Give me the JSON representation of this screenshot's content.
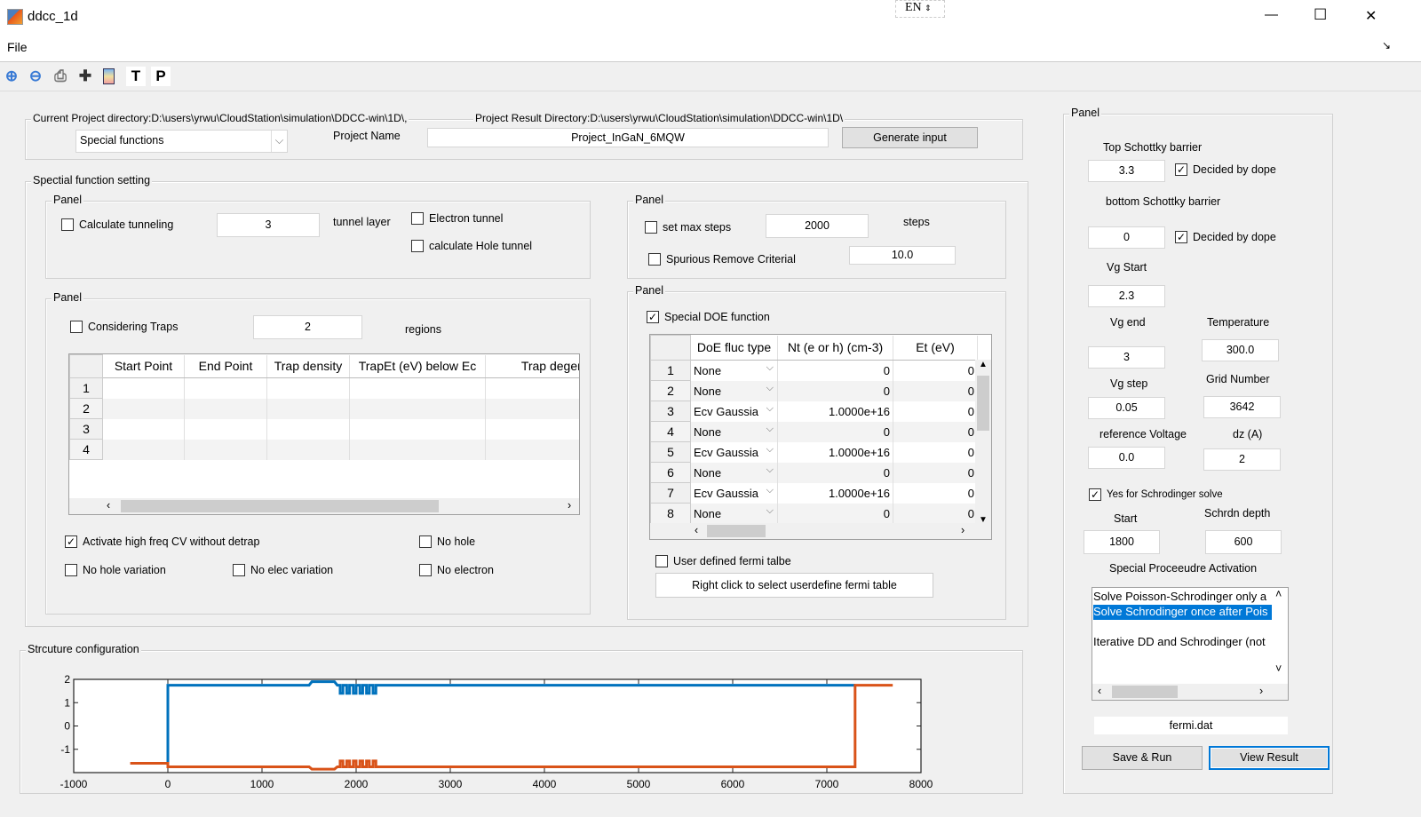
{
  "window": {
    "title": "ddcc_1d",
    "input_indicator": "EN",
    "minimize": "—",
    "maximize": "☐",
    "close": "✕"
  },
  "menu": {
    "file": "File"
  },
  "toolbar": {
    "icons": [
      "zoom-in-icon",
      "zoom-out-icon",
      "print-icon",
      "data-cursor-icon",
      "colorbar-icon",
      "text-icon",
      "p-icon"
    ],
    "t_label": "T",
    "p_label": "P"
  },
  "project": {
    "dir_label": "Current Project directory:D:\\users\\yrwu\\CloudStation\\simulation\\DDCC-win\\1D\\,",
    "result_label": "Project Result Directory:D:\\users\\yrwu\\CloudStation\\simulation\\DDCC-win\\1D\\",
    "mode_select": "Special functions",
    "name_label": "Project Name",
    "name_value": "Project_InGaN_6MQW",
    "generate": "Generate input"
  },
  "special": {
    "title": "Spectial function setting",
    "tunnel_panel": {
      "title": "Panel",
      "calc_tunneling": "Calculate tunneling",
      "tunnel_value": "3",
      "tunnel_layer": "tunnel layer",
      "electron_tunnel": "Electron tunnel",
      "hole_tunnel": "calculate Hole tunnel"
    },
    "steps_panel": {
      "title": "Panel",
      "max_steps": "set max steps",
      "steps_value": "2000",
      "steps": "steps",
      "spurious": "Spurious Remove Criterial",
      "spurious_value": "10.0"
    },
    "trap_panel": {
      "title": "Panel",
      "considering_traps": "Considering Traps",
      "regions_value": "2",
      "regions": "regions",
      "columns": [
        "Start Point",
        "End Point",
        "Trap density",
        "TrapEt (eV) below Ec",
        "Trap degenera"
      ],
      "rows": [
        "1",
        "2",
        "3",
        "4"
      ],
      "activate_cv": "Activate high freq CV without detrap",
      "no_hole": "No hole",
      "no_hole_var": "No hole variation",
      "no_elec_var": "No elec variation",
      "no_electron": "No electron"
    },
    "doe_panel": {
      "title": "Panel",
      "special_doe": "Special DOE function",
      "columns": [
        "DoE fluc type",
        "Nt (e or h) (cm-3)",
        "Et (eV)"
      ],
      "rows": [
        {
          "n": "1",
          "type": "None",
          "nt": "0",
          "et": "0"
        },
        {
          "n": "2",
          "type": "None",
          "nt": "0",
          "et": "0"
        },
        {
          "n": "3",
          "type": "Ecv Gaussia",
          "nt": "1.0000e+16",
          "et": "0"
        },
        {
          "n": "4",
          "type": "None",
          "nt": "0",
          "et": "0"
        },
        {
          "n": "5",
          "type": "Ecv Gaussia",
          "nt": "1.0000e+16",
          "et": "0"
        },
        {
          "n": "6",
          "type": "None",
          "nt": "0",
          "et": "0"
        },
        {
          "n": "7",
          "type": "Ecv Gaussia",
          "nt": "1.0000e+16",
          "et": "0"
        },
        {
          "n": "8",
          "type": "None",
          "nt": "0",
          "et": "0"
        }
      ],
      "user_fermi": "User defined fermi talbe",
      "fermi_button": "Right click to select userdefine fermi table"
    }
  },
  "structure": {
    "title": "Strcuture configuration"
  },
  "right": {
    "title": "Panel",
    "top_schottky": "Top Schottky barrier",
    "top_value": "3.3",
    "decided_by_dope": "Decided by dope",
    "bottom_schottky": "bottom Schottky barrier",
    "bottom_value": "0",
    "vg_start": "Vg Start",
    "vg_start_value": "2.3",
    "vg_end": "Vg end",
    "vg_end_value": "3",
    "temperature": "Temperature",
    "temperature_value": "300.0",
    "vg_step": "Vg step",
    "vg_step_value": "0.05",
    "grid_number": "Grid Number",
    "grid_value": "3642",
    "ref_voltage": "reference Voltage",
    "ref_value": "0.0",
    "dz": "dz (A)",
    "dz_value": "2",
    "schrodinger": "Yes for Schrodinger solve",
    "start": "Start",
    "start_value": "1800",
    "schrdn_depth": "Schrdn depth",
    "depth_value": "600",
    "activation": "Special Proceeudre Activation",
    "list": [
      "Solve Poisson-Schrodinger only a",
      "Solve Schrodinger once after Pois",
      "",
      "Iterative DD and Schrodinger (not"
    ],
    "selected_index": 1,
    "fermi_file": "fermi.dat",
    "save_run": "Save & Run",
    "view_result": "View Result"
  },
  "chart_data": {
    "type": "line",
    "xlim": [
      -1000,
      8000
    ],
    "ylim": [
      -2,
      2
    ],
    "xticks": [
      "-1000",
      "0",
      "1000",
      "2000",
      "3000",
      "4000",
      "5000",
      "6000",
      "7000",
      "8000"
    ],
    "yticks": [
      "2",
      "1",
      "0",
      "-1"
    ],
    "colors": {
      "series1": "#0072bd",
      "series2": "#d95319"
    },
    "series": [
      {
        "points": [
          [
            0,
            -1.6
          ],
          [
            0,
            1.75
          ],
          [
            1500,
            1.75
          ],
          [
            1530,
            1.9
          ],
          [
            1770,
            1.9
          ],
          [
            1800,
            1.75
          ],
          [
            1830,
            1.75
          ],
          [
            1830,
            1.4
          ],
          [
            1860,
            1.4
          ],
          [
            1860,
            1.75
          ],
          [
            1900,
            1.75
          ],
          [
            1900,
            1.4
          ],
          [
            1930,
            1.4
          ],
          [
            1930,
            1.75
          ],
          [
            1970,
            1.75
          ],
          [
            1970,
            1.4
          ],
          [
            2000,
            1.4
          ],
          [
            2000,
            1.75
          ],
          [
            2040,
            1.75
          ],
          [
            2040,
            1.4
          ],
          [
            2070,
            1.4
          ],
          [
            2070,
            1.75
          ],
          [
            2110,
            1.75
          ],
          [
            2110,
            1.4
          ],
          [
            2140,
            1.4
          ],
          [
            2140,
            1.75
          ],
          [
            2180,
            1.75
          ],
          [
            2180,
            1.4
          ],
          [
            2210,
            1.4
          ],
          [
            2210,
            1.75
          ],
          [
            7300,
            1.75
          ]
        ]
      },
      {
        "points": [
          [
            -400,
            -1.6
          ],
          [
            0,
            -1.6
          ],
          [
            0,
            -1.75
          ],
          [
            1500,
            -1.75
          ],
          [
            1530,
            -1.85
          ],
          [
            1770,
            -1.85
          ],
          [
            1800,
            -1.75
          ],
          [
            1830,
            -1.75
          ],
          [
            1830,
            -1.5
          ],
          [
            1860,
            -1.5
          ],
          [
            1860,
            -1.75
          ],
          [
            1900,
            -1.75
          ],
          [
            1900,
            -1.5
          ],
          [
            1930,
            -1.5
          ],
          [
            1930,
            -1.75
          ],
          [
            1970,
            -1.75
          ],
          [
            1970,
            -1.5
          ],
          [
            2000,
            -1.5
          ],
          [
            2000,
            -1.75
          ],
          [
            2040,
            -1.75
          ],
          [
            2040,
            -1.5
          ],
          [
            2070,
            -1.5
          ],
          [
            2070,
            -1.75
          ],
          [
            2110,
            -1.75
          ],
          [
            2110,
            -1.5
          ],
          [
            2140,
            -1.5
          ],
          [
            2140,
            -1.75
          ],
          [
            2180,
            -1.75
          ],
          [
            2180,
            -1.5
          ],
          [
            2210,
            -1.5
          ],
          [
            2210,
            -1.75
          ],
          [
            7300,
            -1.75
          ],
          [
            7300,
            1.75
          ],
          [
            7700,
            1.75
          ]
        ]
      }
    ]
  }
}
